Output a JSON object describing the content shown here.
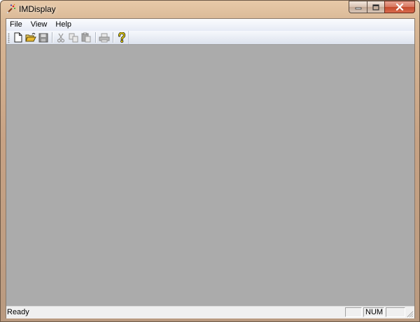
{
  "window": {
    "title": "IMDisplay"
  },
  "menubar": {
    "items": [
      "File",
      "View",
      "Help"
    ]
  },
  "toolbar": {
    "buttons": [
      {
        "icon": "new-document-icon",
        "enabled": true
      },
      {
        "icon": "open-folder-icon",
        "enabled": true
      },
      {
        "icon": "save-icon",
        "enabled": false
      },
      {
        "icon": "cut-icon",
        "enabled": false
      },
      {
        "icon": "copy-icon",
        "enabled": false
      },
      {
        "icon": "paste-icon",
        "enabled": false
      },
      {
        "icon": "print-icon",
        "enabled": false
      },
      {
        "icon": "help-icon",
        "enabled": true
      }
    ]
  },
  "statusbar": {
    "text": "Ready",
    "num_indicator": "NUM",
    "caps_indicator": "",
    "scroll_indicator": ""
  },
  "colors": {
    "workspace": "#ababab",
    "close_button": "#c44a2c",
    "help_icon": "#e8d000"
  }
}
